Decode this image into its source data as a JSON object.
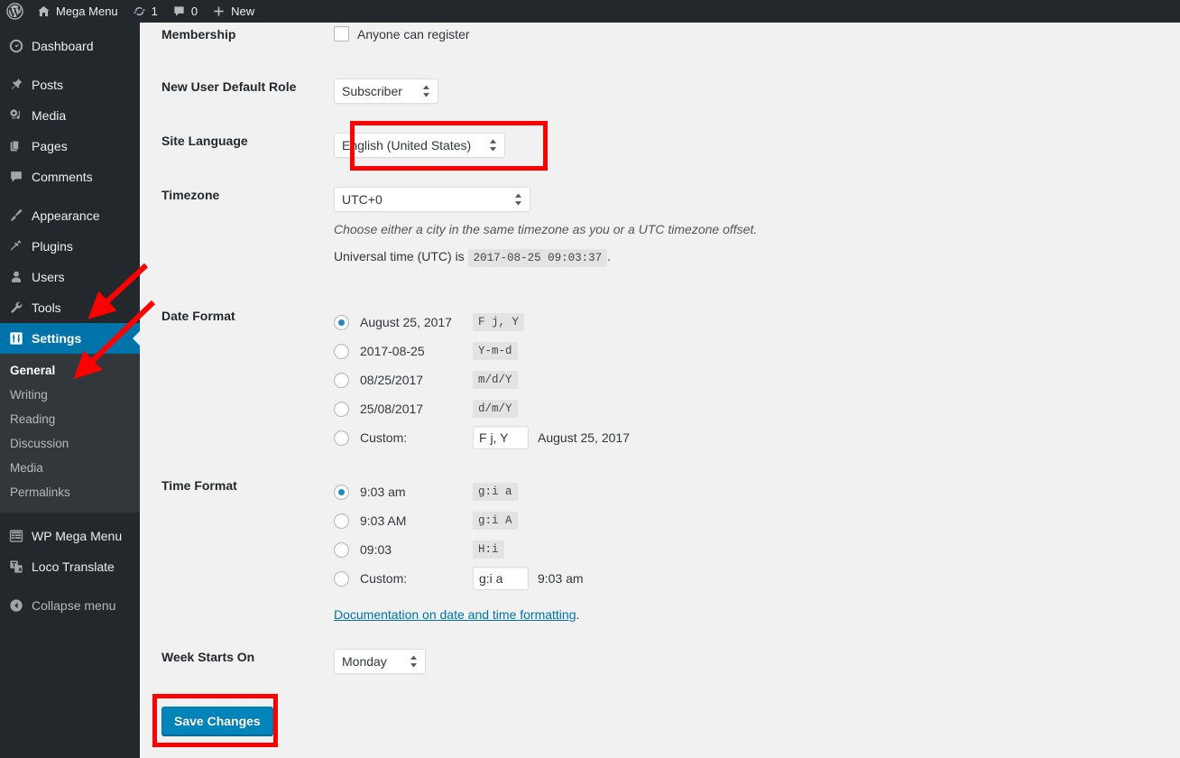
{
  "adminbar": {
    "logo_icon": "wordpress-logo-icon",
    "site_name": "Mega Menu",
    "home_icon": "home-icon",
    "updates_icon": "updates-icon",
    "updates_count": "1",
    "comments_icon": "comments-icon",
    "comments_count": "0",
    "new_icon": "plus-icon",
    "new_label": "New"
  },
  "sidebar": {
    "items": [
      {
        "label": "Dashboard",
        "icon": "dashboard-icon",
        "current": false
      },
      {
        "label": "Posts",
        "icon": "pin-icon",
        "current": false
      },
      {
        "label": "Media",
        "icon": "media-icon",
        "current": false
      },
      {
        "label": "Pages",
        "icon": "pages-icon",
        "current": false
      },
      {
        "label": "Comments",
        "icon": "comment-bubble-icon",
        "current": false
      },
      {
        "label": "Appearance",
        "icon": "brush-icon",
        "current": false
      },
      {
        "label": "Plugins",
        "icon": "plug-icon",
        "current": false
      },
      {
        "label": "Users",
        "icon": "user-icon",
        "current": false
      },
      {
        "label": "Tools",
        "icon": "wrench-icon",
        "current": false
      },
      {
        "label": "Settings",
        "icon": "settings-sliders-icon",
        "current": true
      }
    ],
    "submenu": [
      {
        "label": "General",
        "current": true
      },
      {
        "label": "Writing",
        "current": false
      },
      {
        "label": "Reading",
        "current": false
      },
      {
        "label": "Discussion",
        "current": false
      },
      {
        "label": "Media",
        "current": false
      },
      {
        "label": "Permalinks",
        "current": false
      }
    ],
    "plugins": [
      {
        "label": "WP Mega Menu",
        "icon": "grid-table-icon"
      },
      {
        "label": "Loco Translate",
        "icon": "translate-icon"
      }
    ],
    "collapse": {
      "label": "Collapse menu",
      "icon": "collapse-arrow-icon"
    }
  },
  "settings": {
    "membership": {
      "label": "Membership",
      "checkbox_label": "Anyone can register",
      "checked": false
    },
    "new_user_default_role": {
      "label": "New User Default Role",
      "value": "Subscriber"
    },
    "site_language": {
      "label": "Site Language",
      "value": "English (United States)"
    },
    "timezone": {
      "label": "Timezone",
      "value": "UTC+0",
      "description": "Choose either a city in the same timezone as you or a UTC timezone offset.",
      "utc_prefix": "Universal time (UTC) is",
      "utc_value": "2017-08-25 09:03:37",
      "utc_suffix": "."
    },
    "date_format": {
      "label": "Date Format",
      "options": [
        {
          "text": "August 25, 2017",
          "code": "F j, Y",
          "selected": true
        },
        {
          "text": "2017-08-25",
          "code": "Y-m-d",
          "selected": false
        },
        {
          "text": "08/25/2017",
          "code": "m/d/Y",
          "selected": false
        },
        {
          "text": "25/08/2017",
          "code": "d/m/Y",
          "selected": false
        }
      ],
      "custom_label": "Custom:",
      "custom_value": "F j, Y",
      "custom_preview": "August 25, 2017",
      "custom_selected": false
    },
    "time_format": {
      "label": "Time Format",
      "options": [
        {
          "text": "9:03 am",
          "code": "g:i a",
          "selected": true
        },
        {
          "text": "9:03 AM",
          "code": "g:i A",
          "selected": false
        },
        {
          "text": "09:03",
          "code": "H:i",
          "selected": false
        }
      ],
      "custom_label": "Custom:",
      "custom_value": "g:i a",
      "custom_preview": "9:03 am",
      "custom_selected": false,
      "doc_link": "Documentation on date and time formatting",
      "doc_link_suffix": "."
    },
    "week_starts_on": {
      "label": "Week Starts On",
      "value": "Monday"
    },
    "save_label": "Save Changes"
  },
  "annotations": {
    "highlight_color": "#ff0000",
    "arrow_color": "#ff0000",
    "boxes": [
      {
        "name": "site-language-highlight"
      },
      {
        "name": "save-changes-highlight"
      }
    ],
    "arrows": [
      {
        "name": "arrow-to-tools-settings"
      },
      {
        "name": "arrow-to-general"
      }
    ]
  },
  "theme": {
    "admin_bar_bg": "#23282d",
    "sidebar_bg": "#23282d",
    "submenu_bg": "#32373c",
    "current_menu_bg": "#0073aa",
    "content_bg": "#f1f1f1",
    "button_bg": "#0085ba",
    "link_color": "#0073aa"
  }
}
